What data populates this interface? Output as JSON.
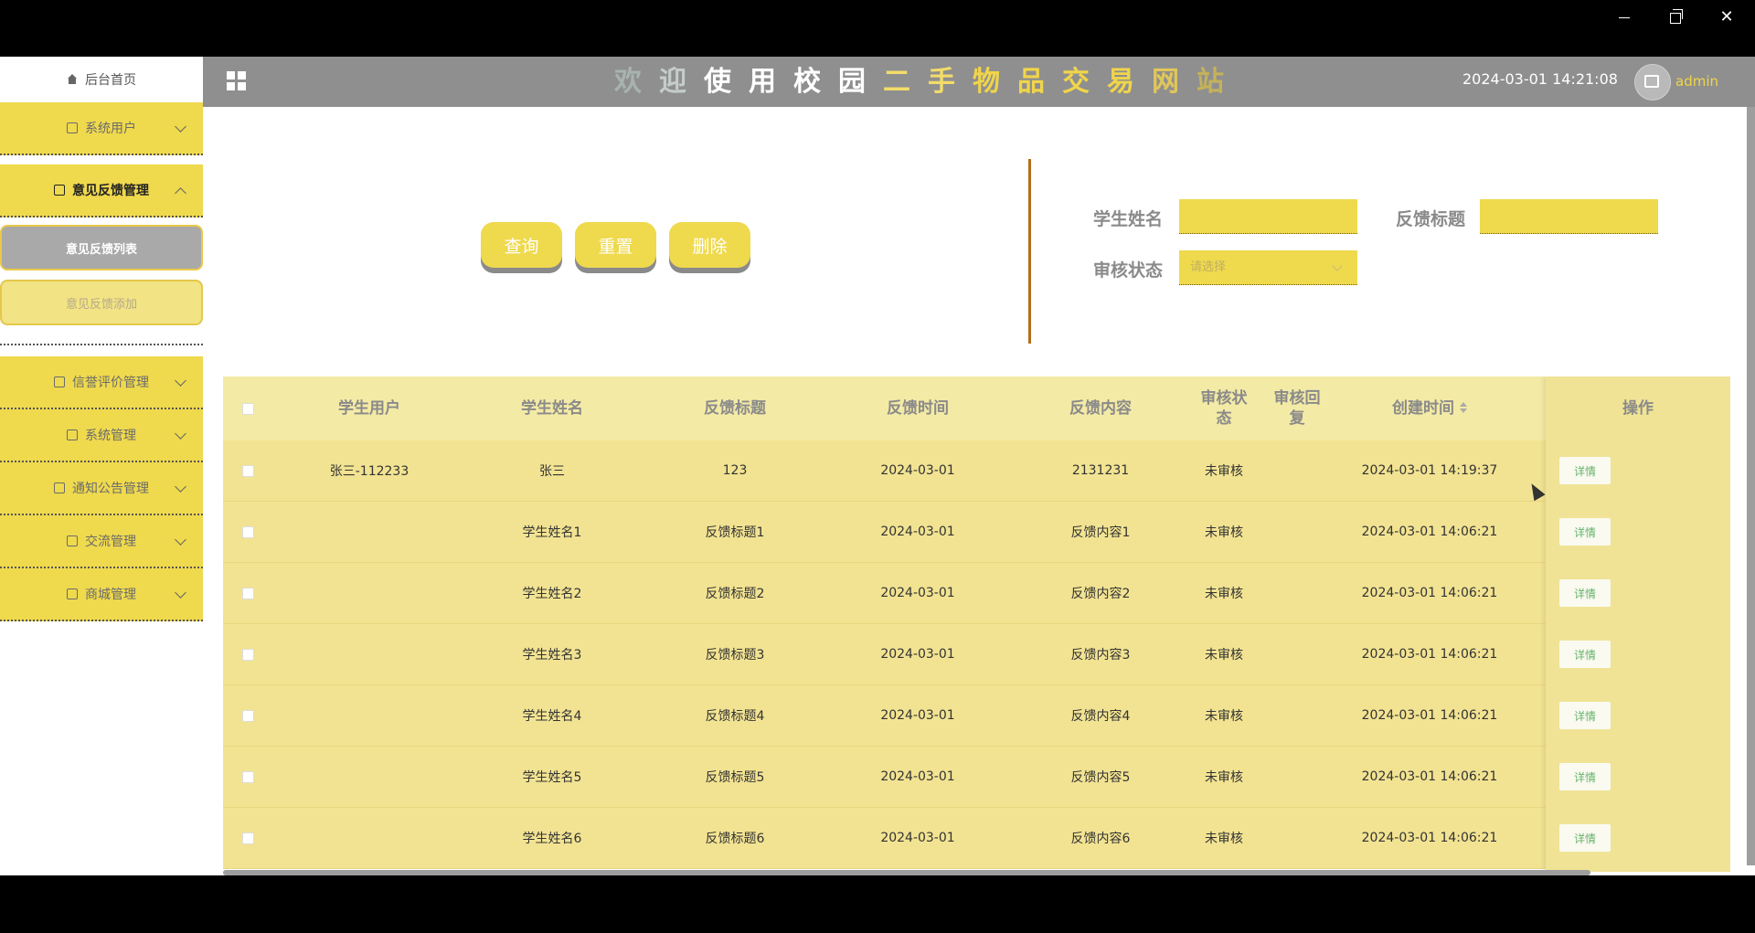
{
  "window": {
    "minimize": "—",
    "maximize": "",
    "close": "✕"
  },
  "header": {
    "title_chars": [
      {
        "ch": "欢",
        "color": "#a8b3b0"
      },
      {
        "ch": "迎",
        "color": "#c5cdc9"
      },
      {
        "ch": "使",
        "color": "#ffffff"
      },
      {
        "ch": "用",
        "color": "#ffffff"
      },
      {
        "ch": "校",
        "color": "#ffffff"
      },
      {
        "ch": "园",
        "color": "#ffffff"
      },
      {
        "ch": "二",
        "color": "#f2dc6a"
      },
      {
        "ch": "手",
        "color": "#f2dc6a"
      },
      {
        "ch": "物",
        "color": "#f0d54a"
      },
      {
        "ch": "品",
        "color": "#f0d54a"
      },
      {
        "ch": "交",
        "color": "#f0d54a"
      },
      {
        "ch": "易",
        "color": "#f0d54a"
      },
      {
        "ch": "网",
        "color": "#e1c65a"
      },
      {
        "ch": "站",
        "color": "#c4b25a"
      }
    ],
    "datetime": "2024-03-01 14:21:08",
    "username": "admin"
  },
  "sidebar": {
    "home": "后台首页",
    "menus": [
      {
        "label": "系统用户",
        "icon": "user-icon",
        "expanded": false
      },
      {
        "label": "意见反馈管理",
        "icon": "feedback-icon",
        "expanded": true,
        "children": [
          {
            "label": "意见反馈列表",
            "selected": true
          },
          {
            "label": "意见反馈添加",
            "selected": false
          }
        ]
      },
      {
        "label": "信誉评价管理",
        "icon": "rating-icon",
        "expanded": false
      },
      {
        "label": "系统管理",
        "icon": "image-icon",
        "expanded": false
      },
      {
        "label": "通知公告管理",
        "icon": "info-icon",
        "expanded": false
      },
      {
        "label": "交流管理",
        "icon": "chat-icon",
        "expanded": false
      },
      {
        "label": "商城管理",
        "icon": "cart-icon",
        "expanded": false
      }
    ]
  },
  "search": {
    "buttons": {
      "query": "查询",
      "reset": "重置",
      "delete": "删除"
    },
    "fields": {
      "student_name_label": "学生姓名",
      "student_name_value": "",
      "feedback_title_label": "反馈标题",
      "feedback_title_value": "",
      "audit_status_label": "审核状态",
      "audit_status_placeholder": "请选择"
    }
  },
  "table": {
    "headers": [
      "学生用户",
      "学生姓名",
      "反馈标题",
      "反馈时间",
      "反馈内容",
      "审核状态",
      "审核回复",
      "创建时间",
      "操作"
    ],
    "detail_label": "详情",
    "rows": [
      {
        "user": "张三-112233",
        "name": "张三",
        "title": "123",
        "time": "2024-03-01",
        "content": "2131231",
        "status": "未审核",
        "reply": "",
        "created": "2024-03-01 14:19:37"
      },
      {
        "user": "",
        "name": "学生姓名1",
        "title": "反馈标题1",
        "time": "2024-03-01",
        "content": "反馈内容1",
        "status": "未审核",
        "reply": "",
        "created": "2024-03-01 14:06:21"
      },
      {
        "user": "",
        "name": "学生姓名2",
        "title": "反馈标题2",
        "time": "2024-03-01",
        "content": "反馈内容2",
        "status": "未审核",
        "reply": "",
        "created": "2024-03-01 14:06:21"
      },
      {
        "user": "",
        "name": "学生姓名3",
        "title": "反馈标题3",
        "time": "2024-03-01",
        "content": "反馈内容3",
        "status": "未审核",
        "reply": "",
        "created": "2024-03-01 14:06:21"
      },
      {
        "user": "",
        "name": "学生姓名4",
        "title": "反馈标题4",
        "time": "2024-03-01",
        "content": "反馈内容4",
        "status": "未审核",
        "reply": "",
        "created": "2024-03-01 14:06:21"
      },
      {
        "user": "",
        "name": "学生姓名5",
        "title": "反馈标题5",
        "time": "2024-03-01",
        "content": "反馈内容5",
        "status": "未审核",
        "reply": "",
        "created": "2024-03-01 14:06:21"
      },
      {
        "user": "",
        "name": "学生姓名6",
        "title": "反馈标题6",
        "time": "2024-03-01",
        "content": "反馈内容6",
        "status": "未审核",
        "reply": "",
        "created": "2024-03-01 14:06:21"
      }
    ]
  }
}
